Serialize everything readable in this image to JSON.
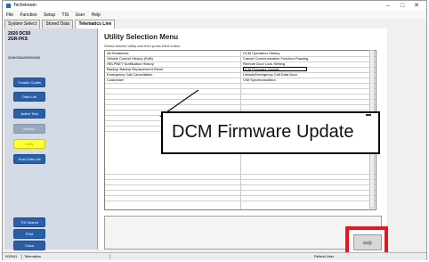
{
  "window": {
    "title": "Techstream",
    "controls": [
      "–",
      "□",
      "✕"
    ]
  },
  "menu": [
    "File",
    "Function",
    "Setup",
    "TIS",
    "User",
    "Help"
  ],
  "tabs": [
    "System Select",
    "Stored Data",
    "Telematics Live"
  ],
  "vehicle": {
    "line1": "2020 DC50",
    "line2": "2GR-FKS",
    "vin": "20/N0000/00000000"
  },
  "sidebar": {
    "buttons": [
      "Trouble Codes",
      "Data List",
      "Active Test",
      "Monitor",
      "Utility",
      "Dual Data List"
    ],
    "bottom_buttons": [
      "TIS Search",
      "Print",
      "Close"
    ]
  },
  "main": {
    "heading": "Utility Selection Menu",
    "instruction": "Select desired Utility and then press Next button.",
    "left_items": [
      "All Readiness",
      "Vehicle Control History (RoB)",
      "HELPNET Notification History",
      "Backup Battery Replacement Reset",
      "Emergency Call Cancellation",
      "Customize"
    ],
    "right_items": [
      "DCM Operation History",
      "Cancel Communication Function Pausing",
      "Remote Door Lock Setting",
      "DCM Firmware Update",
      "Unlock/Emergency Call Data Door",
      "VIM Synchronization"
    ]
  },
  "callout": {
    "text": "DCM Firmware Update"
  },
  "next_button": {
    "icon": "right-arrow-icon",
    "glyph": "➡"
  },
  "status": {
    "left": "000041",
    "mid": "Telematics",
    "right": "Default User"
  },
  "colors": {
    "highlight": "#e8151d",
    "button": "#2a5fa8",
    "utility": "#ffff33"
  }
}
